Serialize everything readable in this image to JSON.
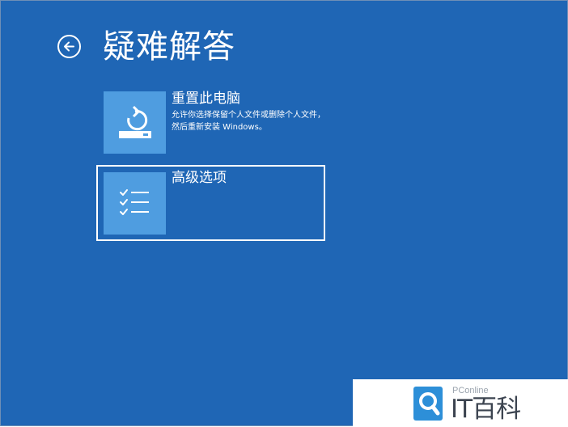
{
  "header": {
    "back_icon": "arrow-left-circle-icon",
    "title": "疑难解答"
  },
  "options": [
    {
      "icon": "reset-pc-icon",
      "title": "重置此电脑",
      "description": "允许你选择保留个人文件或删除个人文件，然后重新安装 Windows。",
      "selected": false
    },
    {
      "icon": "checklist-icon",
      "title": "高级选项",
      "description": "",
      "selected": true
    }
  ],
  "watermark": {
    "icon": "pconline-search-logo-icon",
    "small_text": "PConline",
    "big_text": "IT百科"
  },
  "colors": {
    "background": "#1f66b5",
    "tile": "#4f9de0",
    "text": "#ffffff",
    "watermark_accent": "#2d8fd8"
  }
}
